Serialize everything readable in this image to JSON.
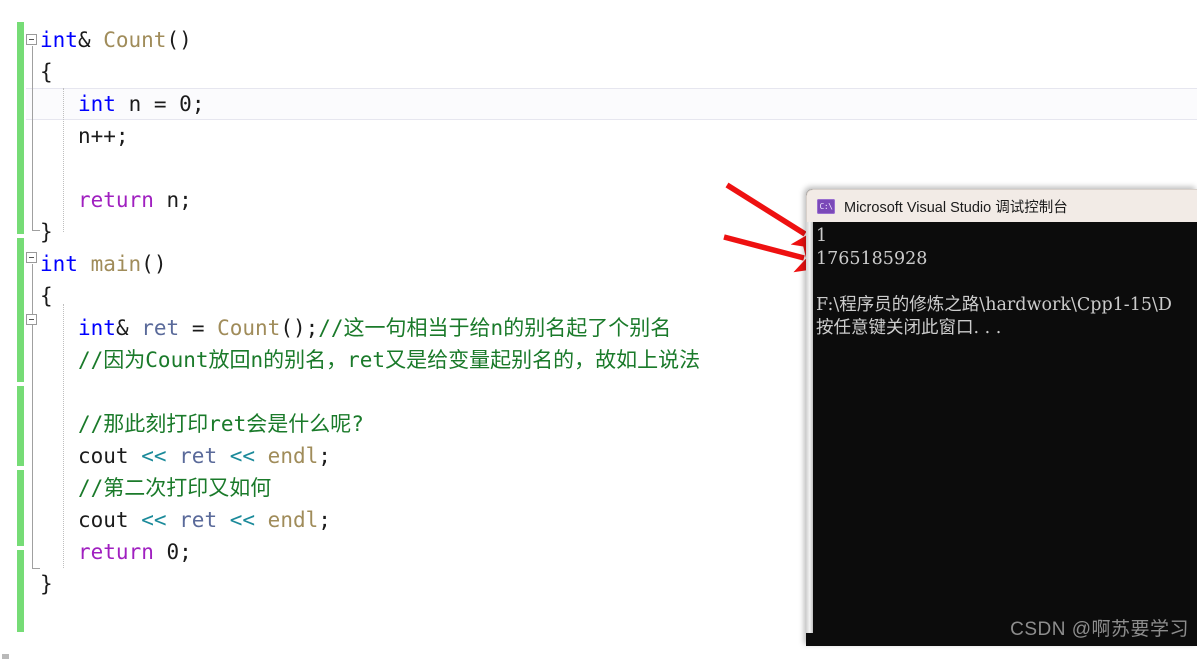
{
  "editor": {
    "language": "cpp",
    "gutter": {
      "change_bar_color": "#76dc76"
    },
    "lines": [
      {
        "n": 1,
        "indent": 0,
        "tokens": [
          {
            "t": "int",
            "c": "kw"
          },
          {
            "t": "& ",
            "c": "ident"
          },
          {
            "t": "Count",
            "c": "fn"
          },
          {
            "t": "()",
            "c": "ident"
          }
        ]
      },
      {
        "n": 2,
        "indent": 0,
        "tokens": [
          {
            "t": "{",
            "c": "brace"
          }
        ]
      },
      {
        "n": 3,
        "indent": 1,
        "tokens": [
          {
            "t": "int",
            "c": "kw"
          },
          {
            "t": " n = ",
            "c": "ident"
          },
          {
            "t": "0",
            "c": "num"
          },
          {
            "t": ";",
            "c": "ident"
          }
        ]
      },
      {
        "n": 4,
        "indent": 1,
        "tokens": [
          {
            "t": "n++;",
            "c": "ident"
          }
        ]
      },
      {
        "n": 5,
        "indent": 1,
        "tokens": []
      },
      {
        "n": 6,
        "indent": 1,
        "tokens": [
          {
            "t": "return",
            "c": "ctrl"
          },
          {
            "t": " n;",
            "c": "ident"
          }
        ]
      },
      {
        "n": 7,
        "indent": 0,
        "tokens": [
          {
            "t": "}",
            "c": "brace"
          }
        ]
      },
      {
        "n": 8,
        "indent": 0,
        "tokens": [
          {
            "t": "int",
            "c": "kw"
          },
          {
            "t": " ",
            "c": "ident"
          },
          {
            "t": "main",
            "c": "fn"
          },
          {
            "t": "()",
            "c": "ident"
          }
        ]
      },
      {
        "n": 9,
        "indent": 0,
        "tokens": [
          {
            "t": "{",
            "c": "brace"
          }
        ]
      },
      {
        "n": 10,
        "indent": 1,
        "tokens": [
          {
            "t": "int",
            "c": "kw"
          },
          {
            "t": "& ",
            "c": "ident"
          },
          {
            "t": "ret",
            "c": "var"
          },
          {
            "t": " = ",
            "c": "ident"
          },
          {
            "t": "Count",
            "c": "fn"
          },
          {
            "t": "();",
            "c": "ident"
          },
          {
            "t": "//这一句相当于给n的别名起了个别名",
            "c": "cmt"
          }
        ]
      },
      {
        "n": 11,
        "indent": 1,
        "tokens": [
          {
            "t": "//因为Count放回n的别名，ret又是给变量起别名的，故如上说法",
            "c": "cmt"
          }
        ]
      },
      {
        "n": 12,
        "indent": 1,
        "tokens": []
      },
      {
        "n": 13,
        "indent": 1,
        "tokens": [
          {
            "t": "//那此刻打印ret会是什么呢?",
            "c": "cmt"
          }
        ]
      },
      {
        "n": 14,
        "indent": 1,
        "tokens": [
          {
            "t": "cout",
            "c": "ident"
          },
          {
            "t": " << ",
            "c": "op"
          },
          {
            "t": "ret",
            "c": "var"
          },
          {
            "t": " << ",
            "c": "op"
          },
          {
            "t": "endl",
            "c": "fn"
          },
          {
            "t": ";",
            "c": "ident"
          }
        ]
      },
      {
        "n": 15,
        "indent": 1,
        "tokens": [
          {
            "t": "//第二次打印又如何",
            "c": "cmt"
          }
        ]
      },
      {
        "n": 16,
        "indent": 1,
        "tokens": [
          {
            "t": "cout",
            "c": "ident"
          },
          {
            "t": " << ",
            "c": "op"
          },
          {
            "t": "ret",
            "c": "var"
          },
          {
            "t": " << ",
            "c": "op"
          },
          {
            "t": "endl",
            "c": "fn"
          },
          {
            "t": ";",
            "c": "ident"
          }
        ]
      },
      {
        "n": 17,
        "indent": 1,
        "tokens": [
          {
            "t": "return",
            "c": "ctrl"
          },
          {
            "t": " ",
            "c": "ident"
          },
          {
            "t": "0",
            "c": "num"
          },
          {
            "t": ";",
            "c": "ident"
          }
        ]
      },
      {
        "n": 18,
        "indent": 0,
        "tokens": [
          {
            "t": "}",
            "c": "brace"
          }
        ]
      }
    ],
    "colors": {
      "keyword": "#0000FF",
      "control": "#A020C0",
      "function": "#A08C5A",
      "comment": "#1A7A2A",
      "operator": "#1B8A9A",
      "variable": "#5A6A9A",
      "text": "#1B1B1B",
      "current_line_bg": "#FBFBFD"
    }
  },
  "console": {
    "title": "Microsoft Visual Studio 调试控制台",
    "icon": "console-icon",
    "icon_label": "C:\\",
    "output": [
      "1",
      "1765185928",
      "",
      "F:\\程序员的修炼之路\\hardwork\\Cpp1-15\\D",
      "按任意键关闭此窗口. . ."
    ],
    "background": "#0C0C0C",
    "foreground": "#CCCCCC",
    "titlebar_background": "#F2EBE6"
  },
  "annotations": {
    "arrow_color": "#EE1111",
    "arrows": [
      {
        "name": "arrow-to-first-output",
        "target": "1"
      },
      {
        "name": "arrow-to-second-output",
        "target": "1765185928"
      }
    ]
  },
  "watermark": {
    "text": "CSDN @啊苏要学习",
    "color": "#8D8D8D"
  }
}
